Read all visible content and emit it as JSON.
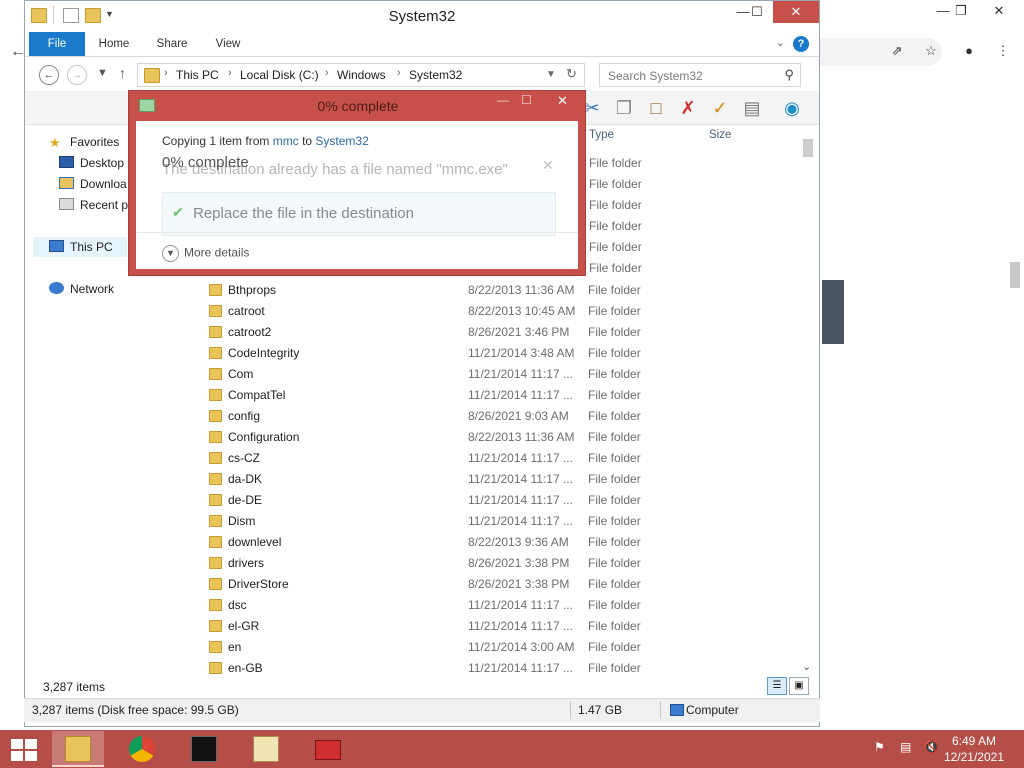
{
  "explorer": {
    "title": "System32",
    "ribbon_tabs": [
      "File",
      "Home",
      "Share",
      "View"
    ],
    "address": {
      "crumbs": [
        "This PC",
        "Local Disk (C:)",
        "Windows",
        "System32"
      ]
    },
    "search_placeholder": "Search System32",
    "columns": {
      "type": "Type",
      "size": "Size"
    },
    "nav_pane": {
      "favorites": "Favorites",
      "desktop": "Desktop",
      "downloads": "Downloa",
      "recent": "Recent pl",
      "this_pc": "This PC",
      "network": "Network"
    },
    "hidden_types": [
      "File folder",
      "File folder",
      "File folder",
      "File folder",
      "File folder",
      "File folder"
    ],
    "files": [
      {
        "name": "Bthprops",
        "date": "8/22/2013 11:36 AM",
        "type": "File folder"
      },
      {
        "name": "catroot",
        "date": "8/22/2013 10:45 AM",
        "type": "File folder"
      },
      {
        "name": "catroot2",
        "date": "8/26/2021 3:46 PM",
        "type": "File folder"
      },
      {
        "name": "CodeIntegrity",
        "date": "11/21/2014 3:48 AM",
        "type": "File folder"
      },
      {
        "name": "Com",
        "date": "11/21/2014 11:17 ...",
        "type": "File folder"
      },
      {
        "name": "CompatTel",
        "date": "11/21/2014 11:17 ...",
        "type": "File folder"
      },
      {
        "name": "config",
        "date": "8/26/2021 9:03 AM",
        "type": "File folder"
      },
      {
        "name": "Configuration",
        "date": "8/22/2013 11:36 AM",
        "type": "File folder"
      },
      {
        "name": "cs-CZ",
        "date": "11/21/2014 11:17 ...",
        "type": "File folder"
      },
      {
        "name": "da-DK",
        "date": "11/21/2014 11:17 ...",
        "type": "File folder"
      },
      {
        "name": "de-DE",
        "date": "11/21/2014 11:17 ...",
        "type": "File folder"
      },
      {
        "name": "Dism",
        "date": "11/21/2014 11:17 ...",
        "type": "File folder"
      },
      {
        "name": "downlevel",
        "date": "8/22/2013 9:36 AM",
        "type": "File folder"
      },
      {
        "name": "drivers",
        "date": "8/26/2021 3:38 PM",
        "type": "File folder"
      },
      {
        "name": "DriverStore",
        "date": "8/26/2021 3:38 PM",
        "type": "File folder"
      },
      {
        "name": "dsc",
        "date": "11/21/2014 11:17 ...",
        "type": "File folder"
      },
      {
        "name": "el-GR",
        "date": "11/21/2014 11:17 ...",
        "type": "File folder"
      },
      {
        "name": "en",
        "date": "11/21/2014 3:00 AM",
        "type": "File folder"
      },
      {
        "name": "en-GB",
        "date": "11/21/2014 11:17 ...",
        "type": "File folder"
      }
    ],
    "item_count": "3,287 items"
  },
  "statusbar": {
    "summary": "3,287 items (Disk free space: 99.5 GB)",
    "size": "1.47 GB",
    "location": "Computer"
  },
  "copy_dialog": {
    "title": "0% complete",
    "copy_prefix": "Copying 1 item from",
    "source": "mmc",
    "to_word": "to",
    "dest": "System32",
    "percent": "0% complete",
    "ghost_message": "The destination already has a file named \"mmc.exe\"",
    "replace_option": "Replace the file in the destination",
    "more_details": "More details"
  },
  "taskbar": {
    "time": "6:49 AM",
    "date": "12/21/2021"
  },
  "colors": {
    "accent": "#1979ca",
    "dialog_frame": "#c7514a",
    "taskbar": "#b54e48"
  }
}
